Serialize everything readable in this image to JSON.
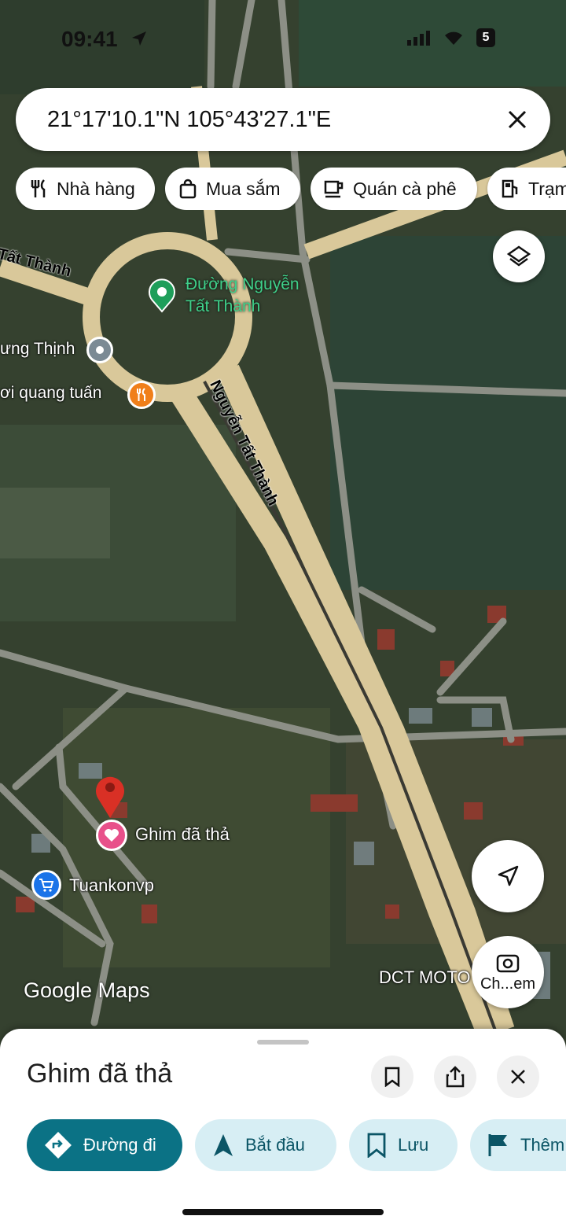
{
  "status_bar": {
    "time": "09:41",
    "battery": "5"
  },
  "search": {
    "value": "21°17'10.1\"N 105°43'27.1\"E"
  },
  "chips": [
    {
      "label": "Nhà hàng",
      "icon": "restaurant-icon"
    },
    {
      "label": "Mua sắm",
      "icon": "shopping-bag-icon"
    },
    {
      "label": "Quán cà phê",
      "icon": "coffee-icon"
    },
    {
      "label": "Trạm",
      "icon": "gas-station-icon"
    }
  ],
  "map": {
    "landmark_label": "Đường Nguyễn\nTất Thành",
    "road_label_top": "Tất Thành",
    "road_label_diag": "Nguyễn Tất Thành",
    "poi_left1": "ưng Thịnh",
    "poi_left2": "ơi quang tuấn",
    "pin_label": "Ghim đã thả",
    "shop_label": "Tuankonvp",
    "business_label": "DCT MOTO",
    "watermark": "Google Maps",
    "camera_label": "Ch...em",
    "colors": {
      "road": "#d9c89a",
      "grass": "#3d4a35",
      "pin": "#d93025",
      "accent": "#0b7285"
    }
  },
  "sheet": {
    "title": "Ghim đã thả",
    "actions": [
      {
        "label": "Đường đi",
        "icon": "directions-icon"
      },
      {
        "label": "Bắt đầu",
        "icon": "navigation-arrow-icon"
      },
      {
        "label": "Lưu",
        "icon": "bookmark-icon"
      },
      {
        "label": "Thêm",
        "icon": "flag-icon"
      }
    ]
  }
}
